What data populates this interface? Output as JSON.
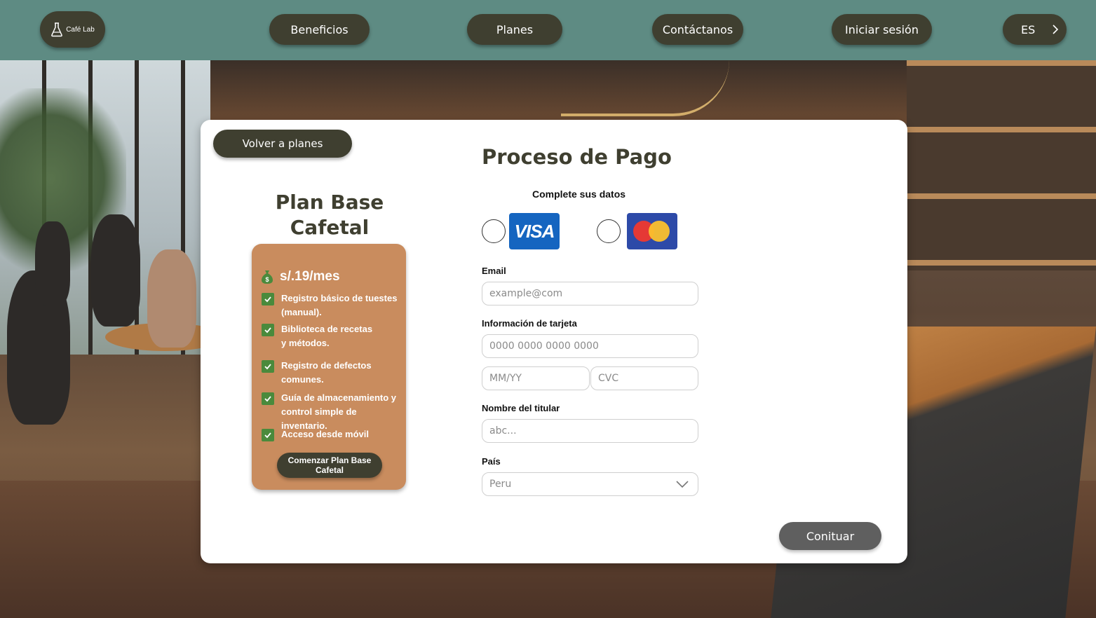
{
  "header": {
    "logo_text": "Café Lab",
    "nav": [
      "Beneficios",
      "Planes",
      "Contáctanos",
      "Iniciar sesión"
    ],
    "language": "ES"
  },
  "back_button": "Volver a planes",
  "plan": {
    "title": "Plan Base Cafetal",
    "price": "s/.19/mes",
    "features": [
      "Registro básico de tuestes (manual).",
      "Biblioteca de recetas y métodos.",
      "Registro de defectos comunes.",
      "Guía de almacenamiento y control simple de inventario.",
      "Acceso desde móvil"
    ],
    "cta": "Comenzar Plan Base Cafetal"
  },
  "payment": {
    "title": "Proceso de Pago",
    "subtitle": "Complete sus datos",
    "card_brands": [
      "VISA",
      "Mastercard"
    ],
    "email_label": "Email",
    "email_placeholder": "example@com",
    "card_label": "Información de tarjeta",
    "card_number_placeholder": "0000 0000 0000 0000",
    "expiry_placeholder": "MM/YY",
    "cvc_placeholder": "CVC",
    "holder_label": "Nombre del titular",
    "holder_placeholder": "abc...",
    "country_label": "País",
    "country_value": "Peru",
    "continue_button": "Conituar"
  },
  "colors": {
    "header_bg": "#5e8b83",
    "dark_button": "#3f3f30",
    "plan_card": "#c98c5e",
    "check_green": "#4a8a3c",
    "continue_button": "#5f5f5f"
  }
}
